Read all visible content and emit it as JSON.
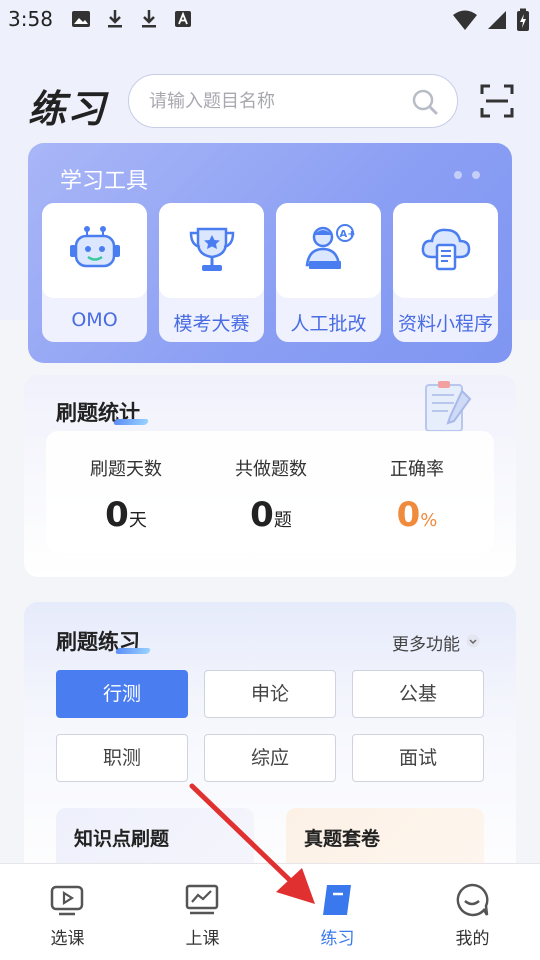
{
  "status_bar": {
    "time": "3:58"
  },
  "header": {
    "title": "练习",
    "search_placeholder": "请输入题目名称"
  },
  "tools": {
    "title": "学习工具",
    "items": [
      {
        "label": "OMO",
        "icon": "robot-icon"
      },
      {
        "label": "模考大赛",
        "icon": "trophy-icon"
      },
      {
        "label": "人工批改",
        "icon": "teacher-icon"
      },
      {
        "label": "资料小程序",
        "icon": "cloud-book-icon"
      }
    ]
  },
  "stats": {
    "title": "刷题统计",
    "items": [
      {
        "label": "刷题天数",
        "value": "0",
        "unit": "天"
      },
      {
        "label": "共做题数",
        "value": "0",
        "unit": "题"
      },
      {
        "label": "正确率",
        "value": "0",
        "unit": "%"
      }
    ]
  },
  "practice": {
    "title": "刷题练习",
    "more": "更多功能",
    "categories": [
      "行测",
      "申论",
      "公基",
      "职测",
      "综应",
      "面试"
    ],
    "active_category": "行测",
    "sub_cards": [
      "知识点刷题",
      "真题套卷"
    ]
  },
  "bottom_nav": {
    "items": [
      {
        "label": "选课",
        "icon": "play-board-icon"
      },
      {
        "label": "上课",
        "icon": "monitor-chart-icon"
      },
      {
        "label": "练习",
        "icon": "notebook-icon"
      },
      {
        "label": "我的",
        "icon": "chat-face-icon"
      }
    ],
    "active": "练习"
  },
  "colors": {
    "accent": "#4a7ef0",
    "tools_card": "#8a9ef3",
    "correct_rate": "#f08a3c",
    "annotation_arrow": "#e03030"
  }
}
